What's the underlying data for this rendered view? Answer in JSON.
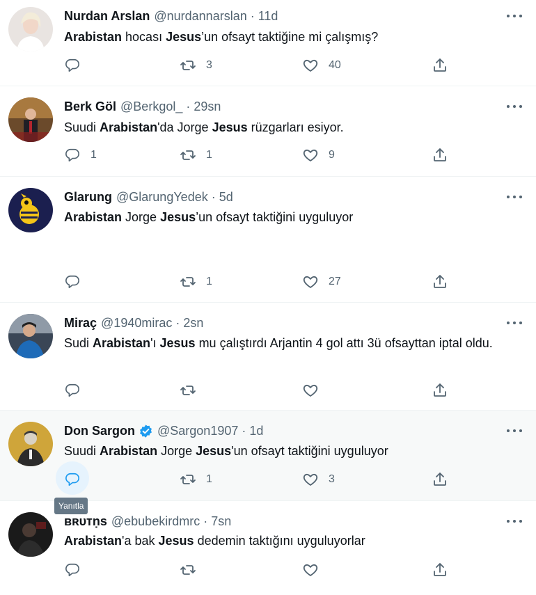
{
  "tweets": [
    {
      "name": "Nurdan Arslan",
      "handle": "@nurdannarslan",
      "sep": "·",
      "time": "11d",
      "segments": [
        {
          "text": "Arabistan",
          "bold": true
        },
        {
          "text": " hocası ",
          "bold": false
        },
        {
          "text": "Jesus",
          "bold": true
        },
        {
          "text": "’un ofsayt taktiğine mi çalışmış?",
          "bold": false
        }
      ],
      "reply_count": "",
      "retweet_count": "3",
      "like_count": "40",
      "verified": false
    },
    {
      "name": "Berk Göl",
      "handle": "@Berkgol_",
      "sep": "·",
      "time": "29sn",
      "segments": [
        {
          "text": "Suudi ",
          "bold": false
        },
        {
          "text": "Arabistan",
          "bold": true
        },
        {
          "text": "'da Jorge ",
          "bold": false
        },
        {
          "text": "Jesus",
          "bold": true
        },
        {
          "text": " rüzgarları esiyor.",
          "bold": false
        }
      ],
      "reply_count": "1",
      "retweet_count": "1",
      "like_count": "9",
      "verified": false
    },
    {
      "name": "Glarung",
      "handle": "@GlarungYedek",
      "sep": "·",
      "time": "5d",
      "segments": [
        {
          "text": "Arabistan",
          "bold": true
        },
        {
          "text": " Jorge ",
          "bold": false
        },
        {
          "text": "Jesus",
          "bold": true
        },
        {
          "text": "’un ofsayt taktiğini uyguluyor",
          "bold": false
        }
      ],
      "reply_count": "",
      "retweet_count": "1",
      "like_count": "27",
      "verified": false
    },
    {
      "name": "Miraç",
      "handle": "@1940mirac",
      "sep": "·",
      "time": "2sn",
      "segments": [
        {
          "text": "Sudi ",
          "bold": false
        },
        {
          "text": "Arabistan",
          "bold": true
        },
        {
          "text": "'ı ",
          "bold": false
        },
        {
          "text": "Jesus",
          "bold": true
        },
        {
          "text": " mu çalıştırdı Arjantin 4 gol attı 3ü ofsayttan iptal oldu.",
          "bold": false
        }
      ],
      "reply_count": "",
      "retweet_count": "",
      "like_count": "",
      "verified": false
    },
    {
      "name": "Don Sargon",
      "handle": "@Sargon1907",
      "sep": "·",
      "time": "1d",
      "segments": [
        {
          "text": "Suudi ",
          "bold": false
        },
        {
          "text": "Arabistan",
          "bold": true
        },
        {
          "text": " Jorge ",
          "bold": false
        },
        {
          "text": "Jesus",
          "bold": true
        },
        {
          "text": "'un ofsayt taktiğini uyguluyor",
          "bold": false
        }
      ],
      "reply_count": "",
      "retweet_count": "1",
      "like_count": "3",
      "verified": true
    },
    {
      "name": "ʙʀᴜᴛṇѕ",
      "handle": "@ebubekirdmrc",
      "sep": "·",
      "time": "7sn",
      "segments": [
        {
          "text": "Arabistan",
          "bold": true
        },
        {
          "text": "'a bak ",
          "bold": false
        },
        {
          "text": "Jesus",
          "bold": true
        },
        {
          "text": " dedemin taktığını uyguluyorlar",
          "bold": false
        }
      ],
      "reply_count": "",
      "retweet_count": "",
      "like_count": "",
      "verified": false
    }
  ],
  "tooltip": "Yanıtla",
  "icons": {
    "reply": "reply-icon",
    "retweet": "retweet-icon",
    "like": "heart-icon",
    "share": "share-icon",
    "more": "more-icon",
    "verified": "verified-badge-icon"
  },
  "colors": {
    "accent": "#1d9bf0",
    "muted": "#536471",
    "hover_bg": "#f7f9f9"
  }
}
